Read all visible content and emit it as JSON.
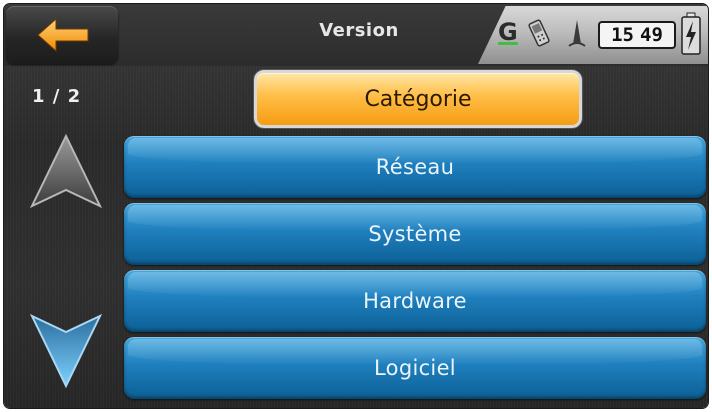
{
  "header": {
    "title": "Version",
    "back_icon": "arrow-left-icon"
  },
  "status": {
    "gps_label": "G",
    "clock_hours": "15",
    "clock_minutes": "49",
    "icons": [
      "gps-icon",
      "phone-icon",
      "signal-icon",
      "battery-charging-icon"
    ]
  },
  "pagination": {
    "label": "1 / 2"
  },
  "category": {
    "label": "Catégorie"
  },
  "menu": {
    "items": [
      {
        "label": "Réseau"
      },
      {
        "label": "Système"
      },
      {
        "label": "Hardware"
      },
      {
        "label": "Logiciel"
      }
    ]
  },
  "colors": {
    "accent_orange": "#F59D14",
    "item_blue": "#1F7FBD",
    "background": "#2E2E2E"
  }
}
